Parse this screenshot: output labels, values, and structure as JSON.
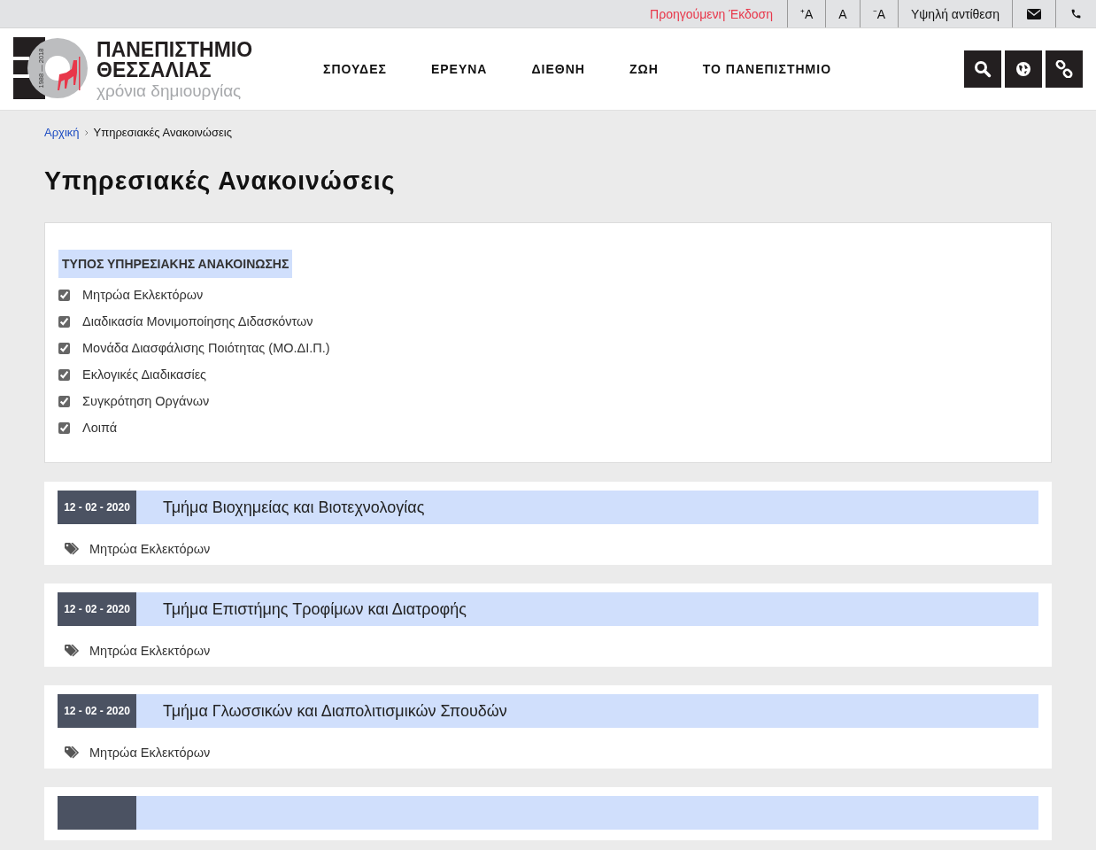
{
  "top_bar": {
    "previous_version": "Προηγούμενη Έκδοση",
    "font_buttons": [
      "⁺A",
      "A",
      "⁻A"
    ],
    "contrast": "Υψηλή αντίθεση"
  },
  "logo": {
    "line_1": "ΠΑΝΕΠΙΣΤΗΜΙΟ",
    "line_2": "ΘΕΣΣΑΛΙΑΣ",
    "tagline": "χρόνια δημιουργίας",
    "years": "1988 — 2018"
  },
  "nav": [
    "ΣΠΟΥΔΕΣ",
    "ΕΡΕΥΝΑ",
    "ΔΙΕΘΝΗ",
    "ΖΩΗ",
    "ΤΟ ΠΑΝΕΠΙΣΤΗΜΙΟ"
  ],
  "breadcrumb": [
    "Αρχική",
    "Υπηρεσιακές Ανακοινώσεις"
  ],
  "page_title": "Υπηρεσιακές Ανακοινώσεις",
  "filter": {
    "heading": "ΤΥΠΟΣ ΥΠΗΡΕΣΙΑΚΗΣ ΑΝΑΚΟΙΝΩΣΗΣ",
    "options": [
      {
        "label": "Μητρώα Εκλεκτόρων",
        "checked": true
      },
      {
        "label": "Διαδικασία Μονιμοποίησης Διδασκόντων",
        "checked": true
      },
      {
        "label": "Μονάδα Διασφάλισης Ποιότητας (ΜΟ.ΔΙ.Π.)",
        "checked": true
      },
      {
        "label": "Εκλογικές Διαδικασίες",
        "checked": true
      },
      {
        "label": "Συγκρότηση Οργάνων",
        "checked": true
      },
      {
        "label": "Λοιπά",
        "checked": true
      }
    ]
  },
  "announcements": [
    {
      "date": "12 - 02 - 2020",
      "title": "Τμήμα Βιοχημείας και Βιοτεχνολογίας",
      "tag": "Μητρώα Εκλεκτόρων"
    },
    {
      "date": "12 - 02 - 2020",
      "title": "Τμήμα Επιστήμης Τροφίμων και Διατροφής",
      "tag": "Μητρώα Εκλεκτόρων"
    },
    {
      "date": "12 - 02 - 2020",
      "title": "Τμήμα Γλωσσικών και Διαπολιτισμικών Σπουδών",
      "tag": "Μητρώα Εκλεκτόρων"
    }
  ],
  "more_below": true
}
